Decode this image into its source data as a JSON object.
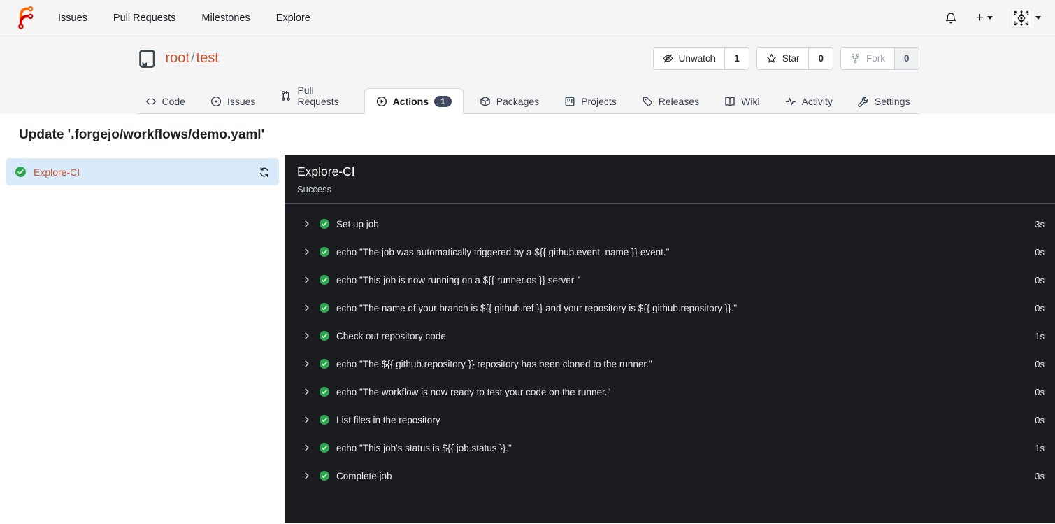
{
  "navbar": {
    "links": [
      {
        "label": "Issues"
      },
      {
        "label": "Pull Requests"
      },
      {
        "label": "Milestones"
      },
      {
        "label": "Explore"
      }
    ],
    "create_label": "+"
  },
  "repo": {
    "owner": "root",
    "separator": "/",
    "name": "test",
    "watch": {
      "label": "Unwatch",
      "count": "1"
    },
    "star": {
      "label": "Star",
      "count": "0"
    },
    "fork": {
      "label": "Fork",
      "count": "0"
    }
  },
  "tabs": {
    "code": "Code",
    "issues": "Issues",
    "pulls": "Pull Requests",
    "actions": "Actions",
    "actions_badge": "1",
    "packages": "Packages",
    "projects": "Projects",
    "releases": "Releases",
    "wiki": "Wiki",
    "activity": "Activity",
    "settings": "Settings"
  },
  "run": {
    "title": "Update '.forgejo/workflows/demo.yaml'",
    "job_name": "Explore-CI",
    "status": "Success"
  },
  "steps": [
    {
      "name": "Set up job",
      "duration": "3s"
    },
    {
      "name": "echo \"The job was automatically triggered by a ${{ github.event_name }} event.\"",
      "duration": "0s"
    },
    {
      "name": "echo \"This job is now running on a ${{ runner.os }} server.\"",
      "duration": "0s"
    },
    {
      "name": "echo \"The name of your branch is ${{ github.ref }} and your repository is ${{ github.repository }}.\"",
      "duration": "0s"
    },
    {
      "name": "Check out repository code",
      "duration": "1s"
    },
    {
      "name": "echo \"The ${{ github.repository }} repository has been cloned to the runner.\"",
      "duration": "0s"
    },
    {
      "name": "echo \"The workflow is now ready to test your code on the runner.\"",
      "duration": "0s"
    },
    {
      "name": "List files in the repository",
      "duration": "0s"
    },
    {
      "name": "echo \"This job's status is ${{ job.status }}.\"",
      "duration": "1s"
    },
    {
      "name": "Complete job",
      "duration": "3s"
    }
  ],
  "colors": {
    "accent_link": "#c7542d",
    "success_green": "#2da44e",
    "selected_job_bg": "#d9eafb",
    "panel_bg": "#1a1c1f",
    "badge_bg": "#404a63",
    "logo_orange": "#ff6600",
    "logo_red": "#d40000"
  }
}
